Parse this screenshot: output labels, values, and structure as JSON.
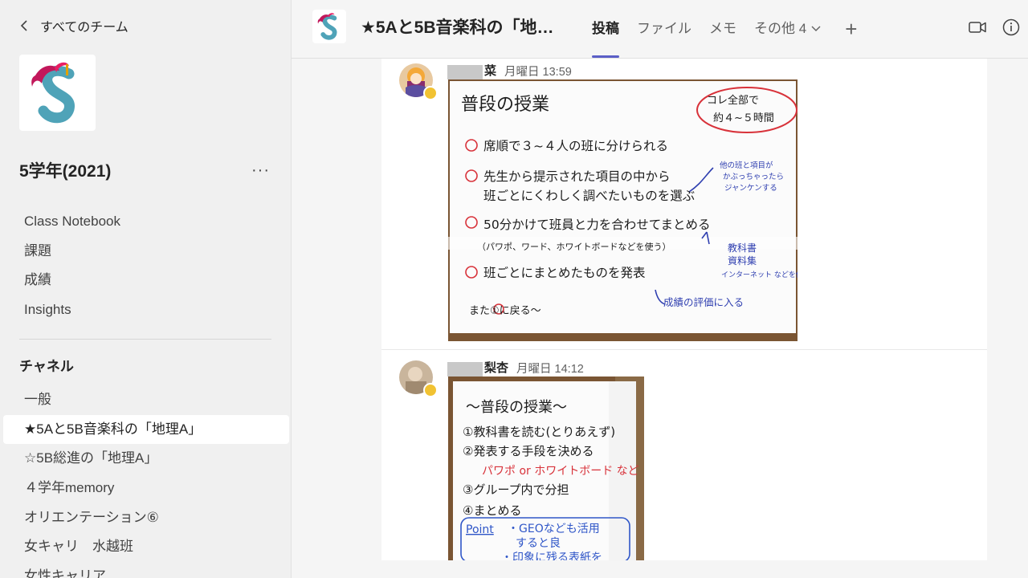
{
  "sidebar": {
    "back_label": "すべてのチーム",
    "team_name": "5学年(2021)",
    "more": "···",
    "nav_items": [
      {
        "label": "Class Notebook"
      },
      {
        "label": "課題"
      },
      {
        "label": "成績"
      },
      {
        "label": "Insights"
      }
    ],
    "channels_header": "チャネル",
    "channels": [
      {
        "label": "一般"
      },
      {
        "label": "★5Aと5B音楽科の「地理A」"
      },
      {
        "label": "☆5B総進の「地理A」"
      },
      {
        "label": "４学年memory"
      },
      {
        "label": "オリエンテーション⑥"
      },
      {
        "label": "女キャリ　水越班"
      },
      {
        "label": "女性キャリア"
      }
    ]
  },
  "header": {
    "title": "★5Aと5B音楽科の「地…",
    "tabs": [
      {
        "label": "投稿"
      },
      {
        "label": "ファイル"
      },
      {
        "label": "メモ"
      },
      {
        "label": "その他 4"
      }
    ],
    "add_tab": "+"
  },
  "posts": [
    {
      "author": "菜",
      "time": "月曜日 13:59",
      "whiteboard": {
        "title": "普段の授業",
        "note": [
          "コレ全部で",
          "約４~５時間"
        ],
        "items": [
          "席順で３~４人の班に分けられる",
          "先生から提示された項目の中から",
          "班ごとにくわしく調べたいものを選ぶ",
          "50分かけて班員と力を合わせてまとめる",
          "（パワポ、ワード、ホワイトボードなどを使う）",
          "班ごとにまとめたものを発表"
        ],
        "side_notes": [
          "他の班と項目が",
          "かぶっちゃったら",
          "ジャンケンする",
          "教科書",
          "資料集",
          "インターネット などを使う",
          "成績の評価に入る"
        ],
        "footer": "また①に戻る～"
      }
    },
    {
      "author": "梨杏",
      "time": "月曜日 14:12",
      "whiteboard": {
        "title": "～普段の授業～",
        "items": [
          "①教科書を読む(とりあえず)",
          "②発表する手段を決める",
          "パワポ or ホワイトボード など",
          "③グループ内で分担",
          "④まとめる"
        ],
        "point_label": "Point",
        "point_text": [
          "・GEOなども活用",
          "すると良",
          "・印象に残る表紙を"
        ]
      }
    }
  ],
  "colors": {
    "accent": "#5b5fc7",
    "status": "#f1c232"
  }
}
